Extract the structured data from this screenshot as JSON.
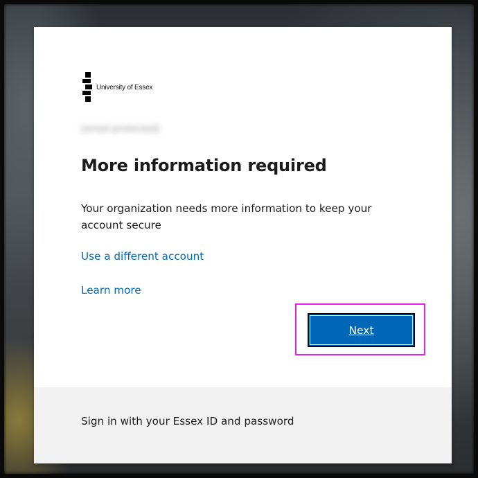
{
  "organization": {
    "logo_text": "University of Essex",
    "logo_icon": "essex-logo-icon"
  },
  "account": {
    "email": "[email protected]"
  },
  "main": {
    "title": "More information required",
    "description": "Your organization needs more information to keep your account secure",
    "use_different_account": "Use a different account",
    "learn_more": "Learn more",
    "next_label": "Next"
  },
  "footer": {
    "text": "Sign in with your Essex ID and password"
  },
  "colors": {
    "link": "#0067b8",
    "primary_button": "#0067b8",
    "highlight": "#e820e8",
    "footer_bg": "#f2f2f2"
  }
}
